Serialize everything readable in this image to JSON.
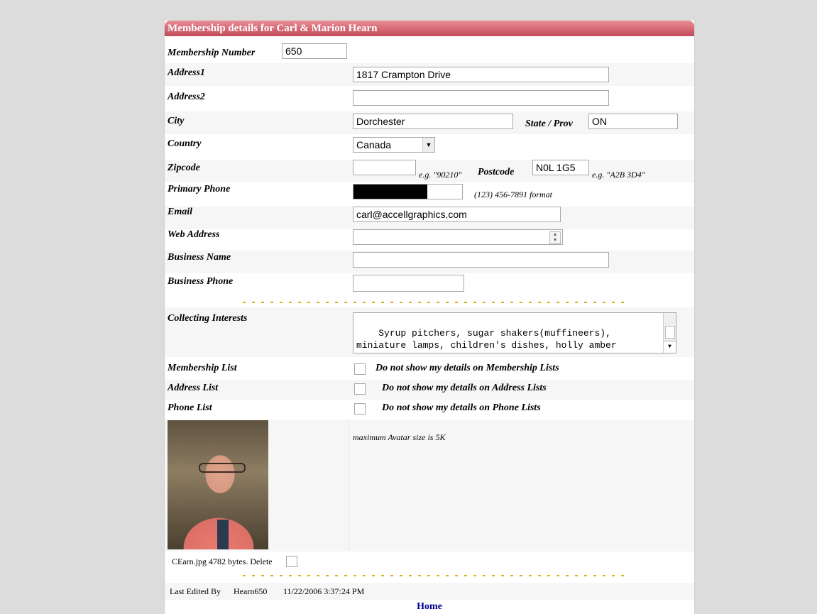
{
  "header": {
    "title": "Membership details for  Carl & Marion Hearn"
  },
  "form": {
    "membership_number": {
      "label": "Membership Number",
      "value": "650"
    },
    "address1": {
      "label": "Address1",
      "value": "1817 Crampton Drive"
    },
    "address2": {
      "label": "Address2",
      "value": ""
    },
    "city": {
      "label": "City",
      "value": "Dorchester"
    },
    "state": {
      "label": "State / Prov",
      "value": "ON"
    },
    "country": {
      "label": "Country",
      "value": "Canada"
    },
    "zipcode": {
      "label": "Zipcode",
      "value": "",
      "hint": "e.g. \"90210\""
    },
    "postcode": {
      "label": "Postcode",
      "value": "N0L 1G5",
      "hint": "e.g. \"A2B 3D4\""
    },
    "primary_phone": {
      "label": "Primary Phone",
      "value": "",
      "hint": "(123) 456-7891 format"
    },
    "email": {
      "label": "Email",
      "value": "carl@accellgraphics.com"
    },
    "web_address": {
      "label": "Web Address",
      "value": ""
    },
    "business_name": {
      "label": "Business Name",
      "value": ""
    },
    "business_phone": {
      "label": "Business Phone",
      "value": ""
    },
    "collecting_interests": {
      "label": "Collecting Interests",
      "value": "Syrup pitchers, sugar shakers(muffineers),\nminiature lamps, children's dishes, holly amber\npattern,  Greentown glass and Northwood's pattern"
    },
    "membership_list": {
      "label": "Membership List",
      "option": "Do not show my details on Membership Lists"
    },
    "address_list": {
      "label": "Address List",
      "option": "Do not show my details on Address Lists"
    },
    "phone_list": {
      "label": "Phone List",
      "option": "Do not show my details on Phone Lists"
    },
    "avatar": {
      "note": "maximum Avatar size is 5K",
      "file_info": "CEarn.jpg 4782 bytes. Delete"
    }
  },
  "footer": {
    "last_edited_label": "Last Edited By",
    "last_edited_by": "Hearn650",
    "last_edited_time": "11/22/2006 3:37:24 PM",
    "home_link": "Home"
  },
  "colors": {
    "title_bar": "#c34a58",
    "divider": "#e8a820",
    "link": "#00008b"
  }
}
